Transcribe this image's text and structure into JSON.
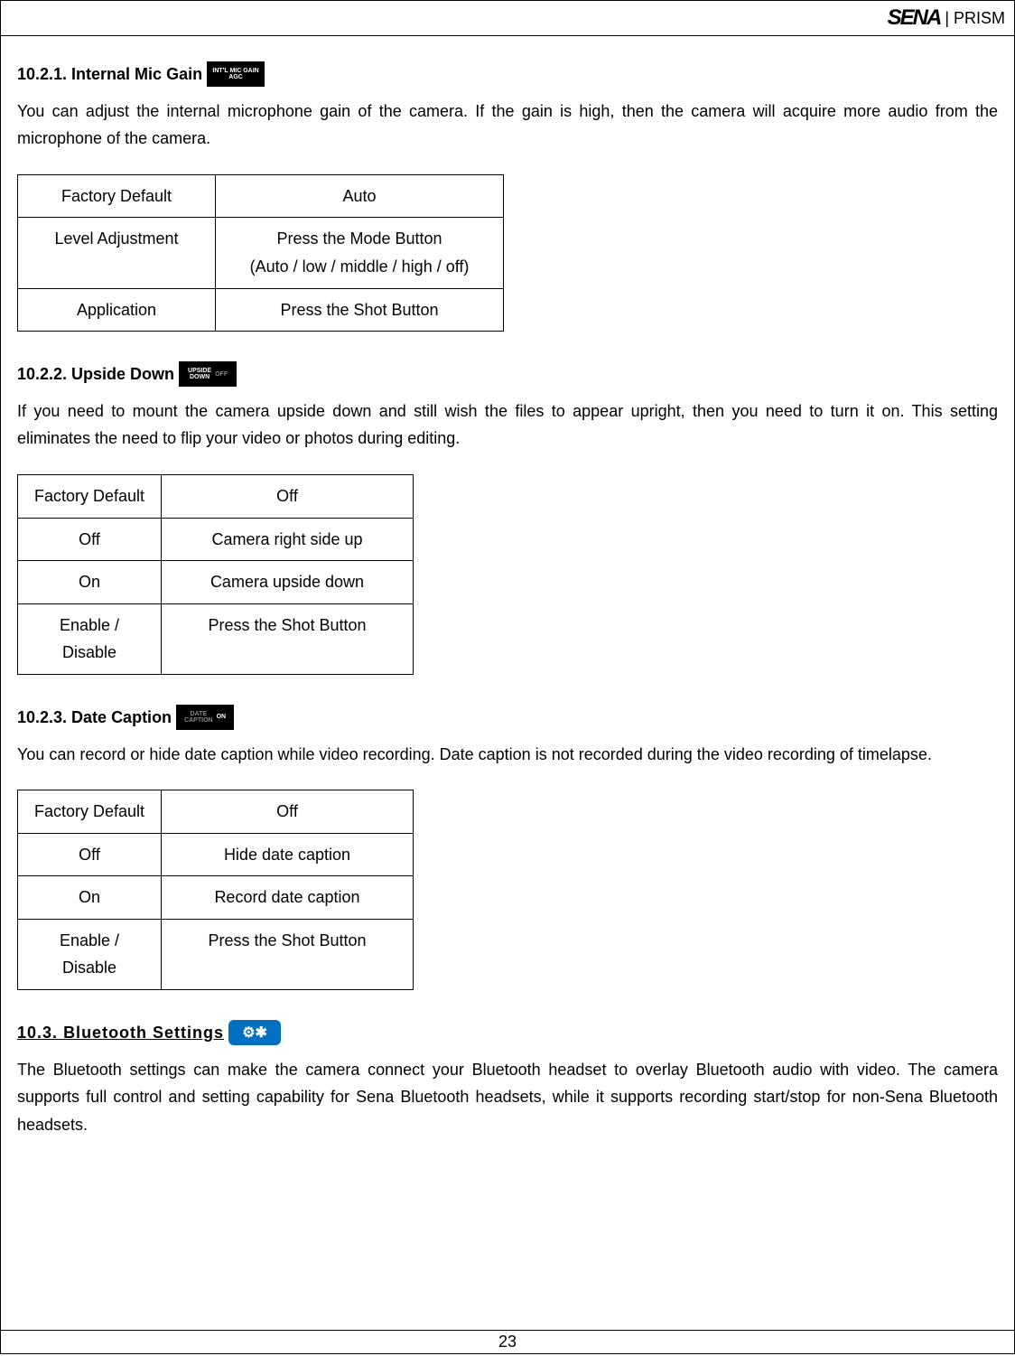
{
  "header": {
    "logo": "SENA",
    "product": "| PRISM"
  },
  "sec1": {
    "num": "10.2.1.",
    "title": "Internal Mic Gain",
    "icon_l1": "INT'L MIC GAIN",
    "icon_l2": "AGC",
    "body": "You can adjust the internal microphone gain of the camera. If the gain is high, then the camera will acquire more audio from the microphone of the camera.",
    "table": [
      [
        "Factory Default",
        "Auto"
      ],
      [
        "Level Adjustment",
        "Press the Mode Button\n(Auto / low / middle / high / off)"
      ],
      [
        "Application",
        "Press the Shot Button"
      ]
    ]
  },
  "sec2": {
    "num": "10.2.2.",
    "title": "Upside Down",
    "icon_l1": "UPSIDE",
    "icon_l2": "DOWN",
    "icon_r": "OFF",
    "body": "If you need to mount the camera upside down and still wish the files to appear upright, then you need to turn it on. This setting eliminates the need to flip your video or photos during editing.",
    "table": [
      [
        "Factory Default",
        "Off"
      ],
      [
        "Off",
        "Camera right side up"
      ],
      [
        "On",
        "Camera upside down"
      ],
      [
        "Enable / Disable",
        "Press the Shot Button"
      ]
    ]
  },
  "sec3": {
    "num": "10.2.3.",
    "title": "Date Caption",
    "icon_l1": "DATE",
    "icon_l2": "CAPTION",
    "icon_r": "ON",
    "body": "You can record or hide date caption while video recording. Date caption is not recorded during the video recording of timelapse.",
    "table": [
      [
        "Factory Default",
        "Off"
      ],
      [
        "Off",
        "Hide date caption"
      ],
      [
        "On",
        "Record date caption"
      ],
      [
        "Enable / Disable",
        "Press the Shot Button"
      ]
    ]
  },
  "sec4": {
    "num": "10.3.",
    "title": "Bluetooth Settings",
    "body": "The Bluetooth settings can make the camera connect your Bluetooth headset to overlay Bluetooth audio with video. The camera supports full control and setting capability for Sena Bluetooth headsets, while it supports recording start/stop for non-Sena Bluetooth headsets."
  },
  "footer": {
    "page": "23"
  }
}
